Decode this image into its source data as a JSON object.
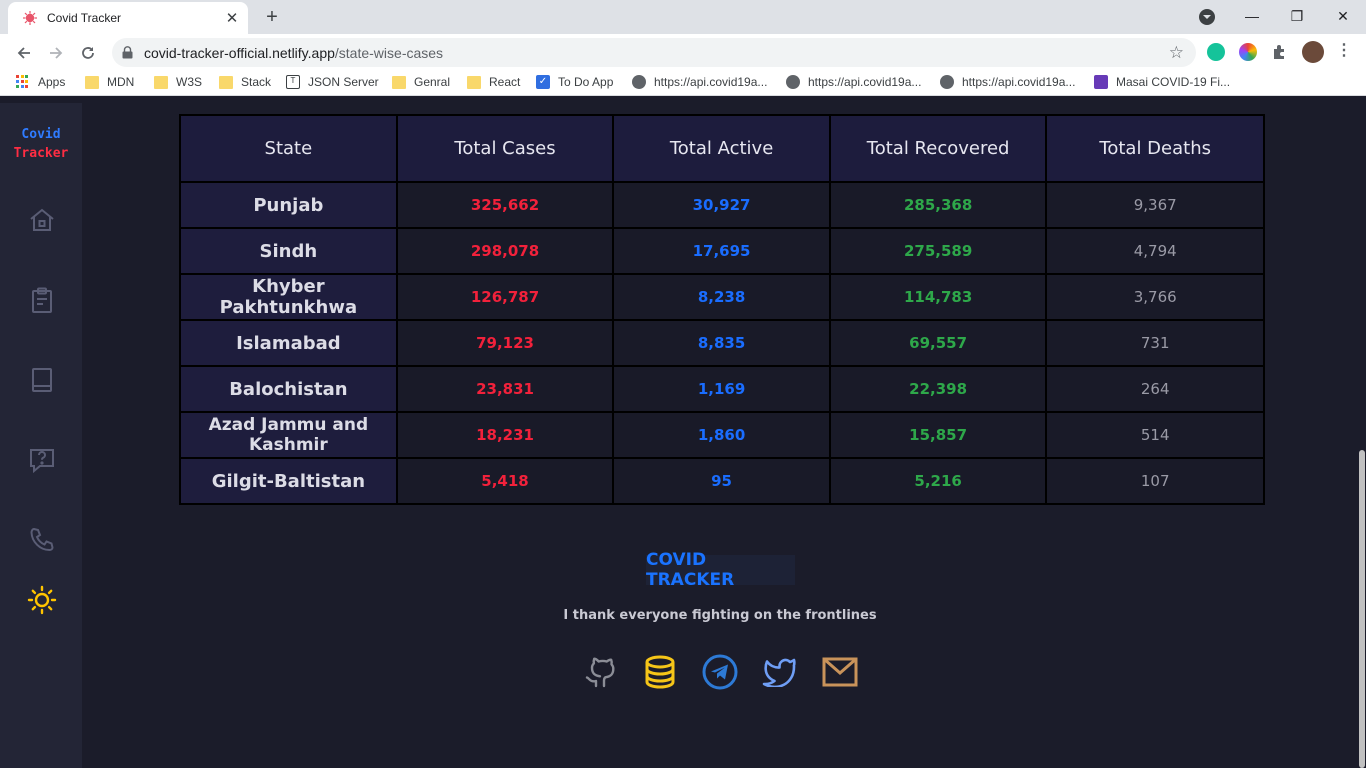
{
  "browser": {
    "tab_title": "Covid Tracker",
    "url_host": "covid-tracker-official.netlify.app",
    "url_path": "/state-wise-cases",
    "bookmarks": [
      {
        "label": "Apps",
        "icon": "apps-grid-icon"
      },
      {
        "label": "MDN",
        "icon": "folder-icon"
      },
      {
        "label": "W3S",
        "icon": "folder-icon"
      },
      {
        "label": "Stack",
        "icon": "folder-icon"
      },
      {
        "label": "JSON Server",
        "icon": "json-server-icon"
      },
      {
        "label": "Genral",
        "icon": "folder-icon"
      },
      {
        "label": "React",
        "icon": "folder-icon"
      },
      {
        "label": "To Do App",
        "icon": "checkbox-icon"
      },
      {
        "label": "https://api.covid19a...",
        "icon": "globe-icon"
      },
      {
        "label": "https://api.covid19a...",
        "icon": "globe-icon"
      },
      {
        "label": "https://api.covid19a...",
        "icon": "globe-icon"
      },
      {
        "label": "Masai COVID-19 Fi...",
        "icon": "form-icon"
      }
    ]
  },
  "app": {
    "logo_line1": "Covid",
    "logo_line2": "Tracker",
    "sidebar_icons": [
      "home-icon",
      "clipboard-icon",
      "book-icon",
      "help-icon",
      "phone-icon",
      "sun-icon"
    ],
    "colors": {
      "cases": "#f2213b",
      "active": "#1a6dff",
      "recovered": "#2ea84a",
      "deaths": "#9a9aa6",
      "sun_accent": "#ffc400"
    }
  },
  "table": {
    "headers": [
      "State",
      "Total Cases",
      "Total Active",
      "Total Recovered",
      "Total Deaths"
    ],
    "rows": [
      [
        "Punjab",
        "325,662",
        "30,927",
        "285,368",
        "9,367"
      ],
      [
        "Sindh",
        "298,078",
        "17,695",
        "275,589",
        "4,794"
      ],
      [
        "Khyber Pakhtunkhwa",
        "126,787",
        "8,238",
        "114,783",
        "3,766"
      ],
      [
        "Islamabad",
        "79,123",
        "8,835",
        "69,557",
        "731"
      ],
      [
        "Balochistan",
        "23,831",
        "1,169",
        "22,398",
        "264"
      ],
      [
        "Azad Jammu and Kashmir",
        "18,231",
        "1,860",
        "15,857",
        "514"
      ],
      [
        "Gilgit-Baltistan",
        "5,418",
        "95",
        "5,216",
        "107"
      ]
    ]
  },
  "footer": {
    "title": "COVID TRACKER",
    "text": "I thank everyone fighting on the frontlines",
    "social_icons": [
      "github-icon",
      "database-icon",
      "telegram-icon",
      "twitter-icon",
      "mail-icon"
    ]
  }
}
